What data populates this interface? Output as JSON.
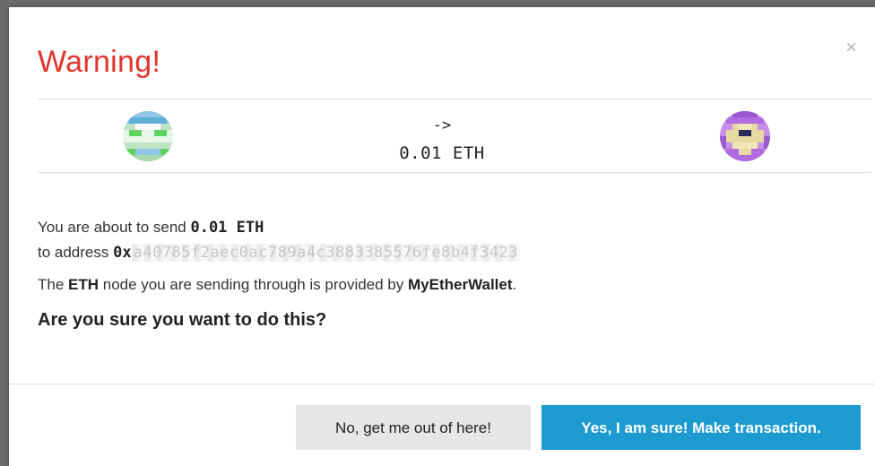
{
  "modal": {
    "title": "Warning!",
    "close_label": "×"
  },
  "transfer": {
    "arrow": "->",
    "amount": "0.01 ETH",
    "from_icon": "identicon",
    "to_icon": "identicon"
  },
  "body": {
    "send_prefix": "You are about to send ",
    "send_amount": "0.01 ETH",
    "address_prefix": "to address ",
    "address_start": "0x",
    "address_rest": "a40785f2aec0ac789a4c3883385576fe8b4f3423",
    "node_prefix": "The ",
    "node_name": "ETH",
    "node_middle": " node you are sending through is provided by ",
    "node_provider": "MyEtherWallet",
    "node_suffix": ".",
    "question": "Are you sure you want to do this?"
  },
  "buttons": {
    "no_label": "No, get me out of here!",
    "yes_label": "Yes, I am sure! Make transaction."
  },
  "colors": {
    "title": "#e0352b",
    "primary": "#1d9bd1",
    "secondary_bg": "#e6e6e6"
  }
}
